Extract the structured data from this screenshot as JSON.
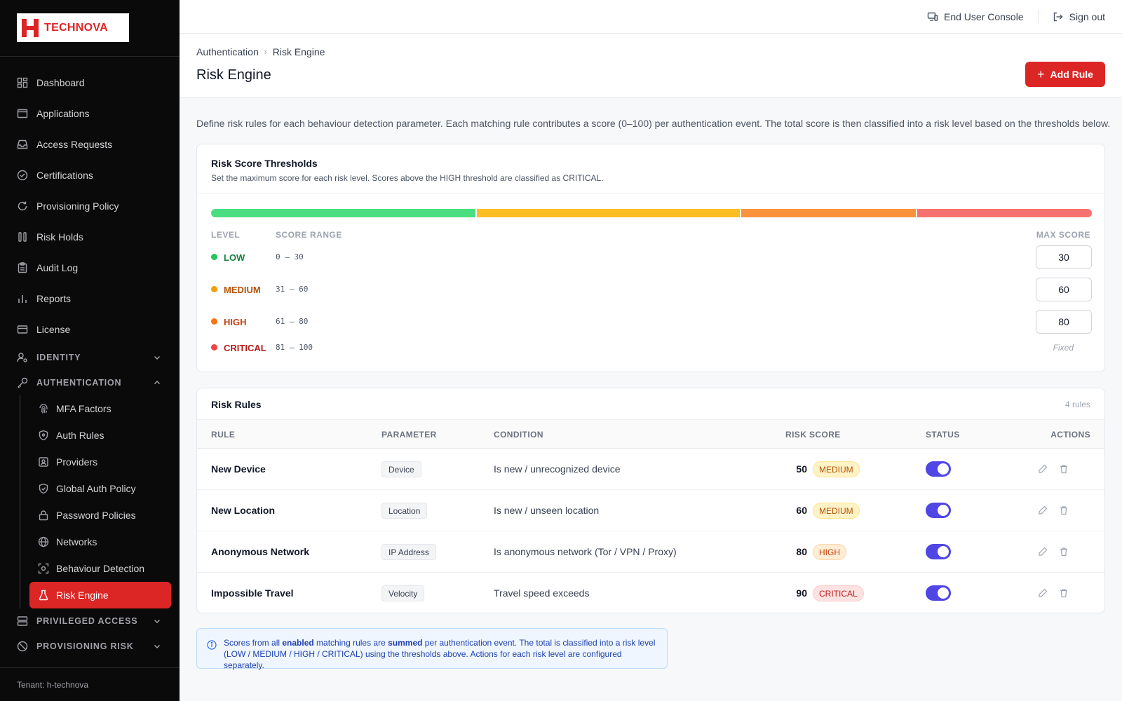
{
  "brand": {
    "name": "TECHNOVA",
    "color": "#dc2626"
  },
  "sidebar": {
    "items": [
      {
        "label": "Dashboard",
        "icon": "dashboard-icon"
      },
      {
        "label": "Applications",
        "icon": "window-icon"
      },
      {
        "label": "Access Requests",
        "icon": "inbox-icon"
      },
      {
        "label": "Certifications",
        "icon": "check-circle-icon"
      },
      {
        "label": "Provisioning Policy",
        "icon": "refresh-icon"
      },
      {
        "label": "Risk Holds",
        "icon": "pause-icon"
      },
      {
        "label": "Audit Log",
        "icon": "clipboard-icon"
      },
      {
        "label": "Reports",
        "icon": "bar-chart-icon"
      },
      {
        "label": "License",
        "icon": "credit-card-icon"
      }
    ],
    "sections": {
      "identity": "IDENTITY",
      "authentication": "AUTHENTICATION",
      "privileged": "PRIVILEGED ACCESS",
      "provisioning_risk": "PROVISIONING RISK"
    },
    "auth_items": [
      {
        "label": "MFA Factors",
        "icon": "fingerprint-icon"
      },
      {
        "label": "Auth Rules",
        "icon": "shield-icon"
      },
      {
        "label": "Providers",
        "icon": "id-card-icon"
      },
      {
        "label": "Global Auth Policy",
        "icon": "shield-check-icon"
      },
      {
        "label": "Password Policies",
        "icon": "lock-icon"
      },
      {
        "label": "Networks",
        "icon": "globe-icon"
      },
      {
        "label": "Behaviour Detection",
        "icon": "scan-icon"
      },
      {
        "label": "Risk Engine",
        "icon": "beaker-icon",
        "active": true
      }
    ],
    "tenant": "Tenant: h-technova"
  },
  "topbar": {
    "console_label": "End User Console",
    "signout_label": "Sign out"
  },
  "header": {
    "breadcrumb": [
      "Authentication",
      "Risk Engine"
    ],
    "title": "Risk Engine",
    "add_label": "Add Rule"
  },
  "intro": "Define risk rules for each behaviour detection parameter. Each matching rule contributes a score (0–100) per authentication event. The total score is then classified into a risk level based on the thresholds below.",
  "thresholds": {
    "title": "Risk Score Thresholds",
    "subtitle": "Set the maximum score for each risk level. Scores above the HIGH threshold are classified as CRITICAL.",
    "col_level": "LEVEL",
    "col_range": "SCORE RANGE",
    "col_max": "MAX SCORE",
    "bar_segments": [
      {
        "level": "LOW",
        "fraction": 0.3,
        "color": "#4ade80"
      },
      {
        "level": "MEDIUM",
        "fraction": 0.3,
        "color": "#fbbf24"
      },
      {
        "level": "HIGH",
        "fraction": 0.2,
        "color": "#fb923c"
      },
      {
        "level": "CRITICAL",
        "fraction": 0.2,
        "color": "#f87171"
      }
    ],
    "levels": [
      {
        "name": "LOW",
        "range": "0 – 30",
        "max": "30",
        "dot": "#22c55e",
        "text": "#15803d"
      },
      {
        "name": "MEDIUM",
        "range": "31 – 60",
        "max": "60",
        "dot": "#f59e0b",
        "text": "#b45309"
      },
      {
        "name": "HIGH",
        "range": "61 – 80",
        "max": "80",
        "dot": "#f97316",
        "text": "#c2410c"
      },
      {
        "name": "CRITICAL",
        "range": "81 – 100",
        "max": "Fixed",
        "dot": "#ef4444",
        "text": "#b91c1c"
      }
    ]
  },
  "rules": {
    "title": "Risk Rules",
    "count": "4 rules",
    "columns": {
      "rule": "RULE",
      "parameter": "PARAMETER",
      "condition": "CONDITION",
      "score": "RISK SCORE",
      "status": "STATUS",
      "actions": "ACTIONS"
    },
    "rows": [
      {
        "rule": "New Device",
        "parameter": "Device",
        "condition": "Is new / unrecognized device",
        "score": "50",
        "level": "MEDIUM",
        "enabled": true
      },
      {
        "rule": "New Location",
        "parameter": "Location",
        "condition": "Is new / unseen location",
        "score": "60",
        "level": "MEDIUM",
        "enabled": true
      },
      {
        "rule": "Anonymous Network",
        "parameter": "IP Address",
        "condition": "Is anonymous network (Tor / VPN / Proxy)",
        "score": "80",
        "level": "HIGH",
        "enabled": true
      },
      {
        "rule": "Impossible Travel",
        "parameter": "Velocity",
        "condition": "Travel speed exceeds",
        "score": "90",
        "level": "CRITICAL",
        "enabled": true
      }
    ]
  },
  "info": {
    "p1": "Scores from all ",
    "b1": "enabled",
    "p2": " matching rules are ",
    "b2": "summed",
    "p3": " per authentication event. The total is classified into a risk level (LOW / MEDIUM / HIGH / CRITICAL) using the thresholds above. Actions for each risk level are configured separately."
  }
}
